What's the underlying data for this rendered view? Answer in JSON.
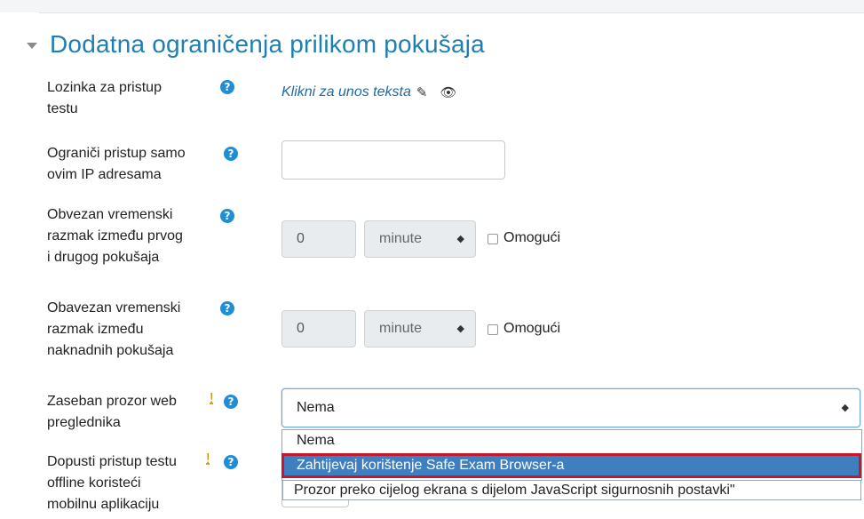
{
  "section": {
    "title": "Dodatna ograničenja prilikom pokušaja",
    "caret_icon": "caret-down-icon"
  },
  "fields": {
    "password": {
      "label_line1": "Lozinka za pristup",
      "label_line2": "testu",
      "inplace_text": "Klikni za unos teksta",
      "edit_icon": "pencil-icon",
      "reveal_icon": "eye-icon"
    },
    "ip": {
      "label_line1": "Ograniči pristup samo",
      "label_line2": "ovim IP adresama",
      "value": ""
    },
    "delay1": {
      "label_line1": "Obvezan vremenski",
      "label_line2": "razmak između prvog",
      "label_line3": "i drugog pokušaja",
      "number": "0",
      "unit": "minute",
      "enable_label": "Omogući"
    },
    "delay2": {
      "label_line1": "Obavezan vremenski",
      "label_line2": "razmak između",
      "label_line3": "naknadnih pokušaja",
      "number": "0",
      "unit": "minute",
      "enable_label": "Omogući"
    },
    "browser": {
      "label_line1": "Zaseban prozor web",
      "label_line2": "preglednika",
      "warn_mark": "!",
      "selected": "Nema",
      "options": [
        "Nema",
        "Zahtijevaj korištenje Safe Exam Browser-a",
        "Prozor preko cijelog ekrana s dijelom JavaScript sigurnosnih postavki\""
      ]
    },
    "offline": {
      "label_line1": "Dopusti pristup testu",
      "label_line2": "offline koristeći",
      "label_line3": "mobilnu aplikaciju",
      "warn_mark": "!"
    }
  },
  "help_glyph": "?",
  "select_arrows": "▲▼",
  "colors": {
    "title": "#1f7fb3",
    "help": "#1f8ed6",
    "selected_option": "#3f7fc0",
    "highlight_border": "#c4182e"
  }
}
